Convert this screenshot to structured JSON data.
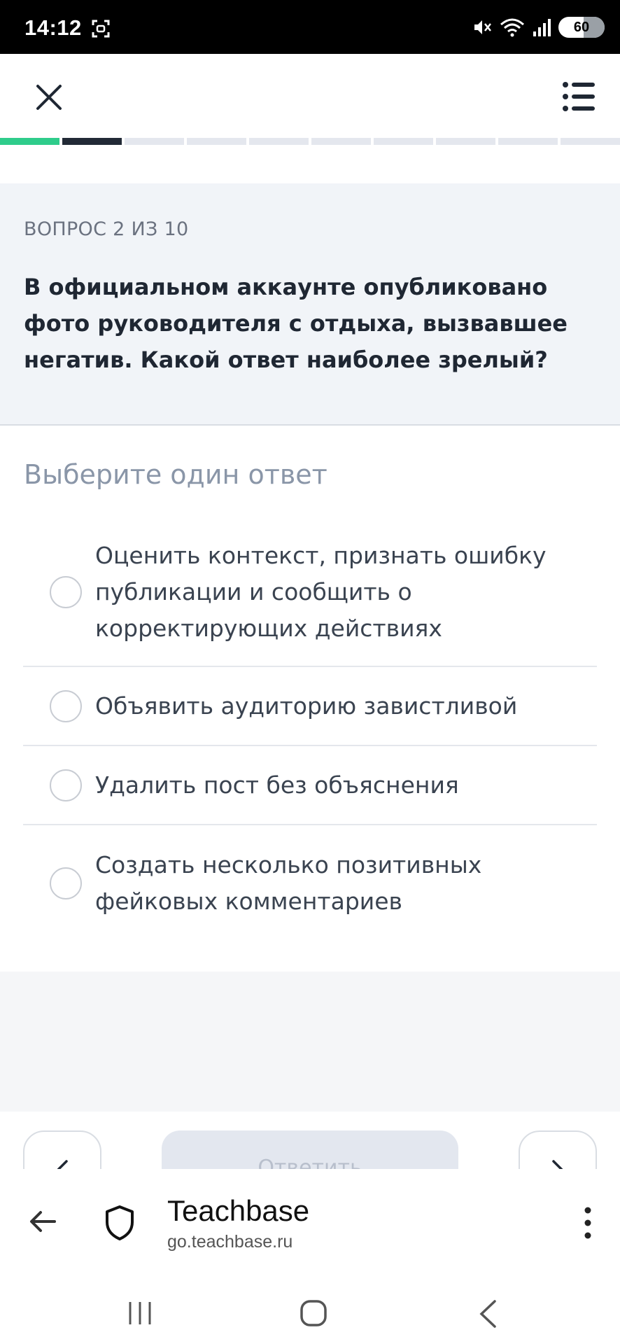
{
  "status_bar": {
    "time": "14:12",
    "battery": "60",
    "icons": [
      "screen-record-icon",
      "mute-icon",
      "wifi-icon",
      "signal-icon",
      "battery-icon"
    ]
  },
  "top_bar": {
    "close_icon": "close-icon",
    "menu_icon": "list-menu-icon"
  },
  "progress": {
    "total_segments": 10,
    "done_segments": 1,
    "current_segment": 2,
    "colors": {
      "done": "#2ecc8b",
      "current": "#222a36",
      "pending": "#e4e7ee"
    }
  },
  "question": {
    "counter": "ВОПРОС 2 ИЗ 10",
    "text": "В официальном аккаунте опубликовано фото руководителя с отдыха, вызвавшее негатив. Какой ответ наиболее зрелый?"
  },
  "answers": {
    "hint": "Выберите один ответ",
    "options": [
      {
        "label": "Оценить контекст, признать ошибку публикации и сообщить о корректирующих действиях"
      },
      {
        "label": "Объявить аудиторию завистливой"
      },
      {
        "label": "Удалить пост без объяснения"
      },
      {
        "label": "Создать несколько позитивных фейковых комментариев"
      }
    ]
  },
  "bottom_nav": {
    "answer_button": "Ответить",
    "prev_icon": "chevron-left-icon",
    "next_icon": "chevron-right-icon"
  },
  "browser": {
    "title": "Teachbase",
    "url": "go.teachbase.ru"
  }
}
